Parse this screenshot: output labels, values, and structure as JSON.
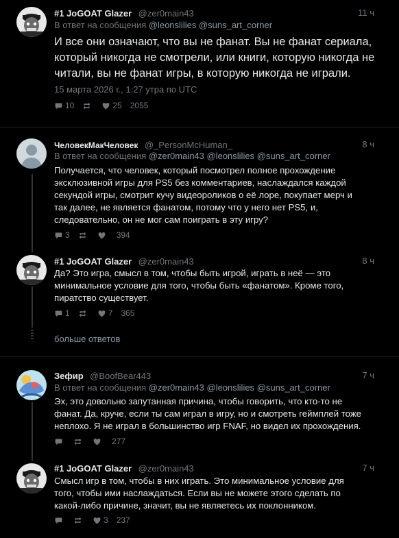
{
  "icons": {
    "reply": "reply-icon",
    "retweet": "retweet-icon",
    "like": "heart-icon"
  },
  "posts": [
    {
      "name": "#1 JoGOAT Glazer",
      "handle": "@zer0main43",
      "time": "11 ч",
      "reply_to_label": "В ответ на сообщения",
      "reply_to": "@leonslilies @suns_art_corner",
      "text": "И все они означают, что вы не фанат. Вы не фанат сериала, который никогда не смотрели, или книги, которую никогда не читали, вы не фанат игры, в которую никогда не играли.",
      "date": "15 марта 2026 г., 1:27 утра по UTC",
      "replies": "10",
      "retweets": "",
      "likes": "25",
      "views": "2055"
    },
    {
      "name": "ЧеловекМакЧеловек",
      "handle": "@_PersonMcHuman_",
      "time": "8 ч",
      "reply_to_label": "В ответ на сообщения",
      "reply_to": "@zer0main43 @leonslilies @suns_art_corner",
      "text": "Получается, что человек, который посмотрел полное прохождение эксклюзивной игры для PS5 без комментариев, наслаждался каждой секундой игры, смотрит кучу видеороликов о её лоре, покупает мерч и так далее, не является фанатом, потому что у него нет PS5, и, следовательно, он не мог сам поиграть в эту игру?",
      "replies": "3",
      "retweets": "",
      "likes": "",
      "views": "394"
    },
    {
      "name": "#1 JoGOAT Glazer",
      "handle": "@zer0main43",
      "time": "8 ч",
      "text": "Да? Это игра, смысл в том, чтобы быть игрой, играть в неё — это минимальное условие для того, чтобы быть «фанатом». Кроме того, пиратство существует.",
      "replies": "1",
      "retweets": "",
      "likes": "7",
      "views": "365"
    },
    {
      "name": "Зефир",
      "handle": "@BoofBear443",
      "time": "7 ч",
      "reply_to_label": "В ответ на сообщения",
      "reply_to": "@zer0main43 @leonslilies @suns_art_corner",
      "text": "Эх, это довольно запутанная причина, чтобы говорить, что кто-то не фанат. Да, круче, если ты сам играл в игру, но и смотреть геймплей тоже неплохо. Я не играл в большинство игр FNAF, но видел их прохождения.",
      "replies": "",
      "retweets": "",
      "likes": "",
      "views": "277"
    },
    {
      "name": "#1 JoGOAT Glazer",
      "handle": "@zer0main43",
      "time": "7 ч",
      "text": "Смысл игр в том, чтобы в них играть. Это минимальное условие для того, чтобы ими наслаждаться. Если вы не можете этого сделать по какой-либо причине, значит, вы не являетесь их поклонником.",
      "replies": "",
      "retweets": "",
      "likes": "3",
      "views": "237"
    }
  ],
  "more_replies": "больше ответов"
}
